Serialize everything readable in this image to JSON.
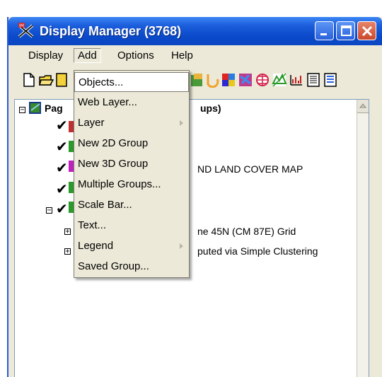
{
  "window": {
    "title": "Display Manager (3768)"
  },
  "menubar": {
    "items": [
      "Display",
      "Add",
      "Options",
      "Help"
    ]
  },
  "add_menu": {
    "items": [
      {
        "label": "Objects...",
        "submenu": false
      },
      {
        "label": "Web Layer...",
        "submenu": false
      },
      {
        "label": "Layer",
        "submenu": true
      },
      {
        "label": "New 2D Group",
        "submenu": false
      },
      {
        "label": "New 3D Group",
        "submenu": false
      },
      {
        "label": "Multiple Groups...",
        "submenu": false
      },
      {
        "label": "Scale Bar...",
        "submenu": false
      },
      {
        "label": "Text...",
        "submenu": false
      },
      {
        "label": "Legend",
        "submenu": true
      },
      {
        "label": "Saved Group...",
        "submenu": false
      }
    ]
  },
  "tree": {
    "root_label_visible": "Pag",
    "root_label_tail": "ups)",
    "row_land_cover": "ND LAND COVER MAP",
    "row_grid": "ne 45N (CM 87E) Grid",
    "row_clustering": "puted via Simple Clustering"
  },
  "colors": {
    "title_blue": "#0a49c9",
    "window_bg": "#ece9d8",
    "close_red": "#c9482c"
  }
}
